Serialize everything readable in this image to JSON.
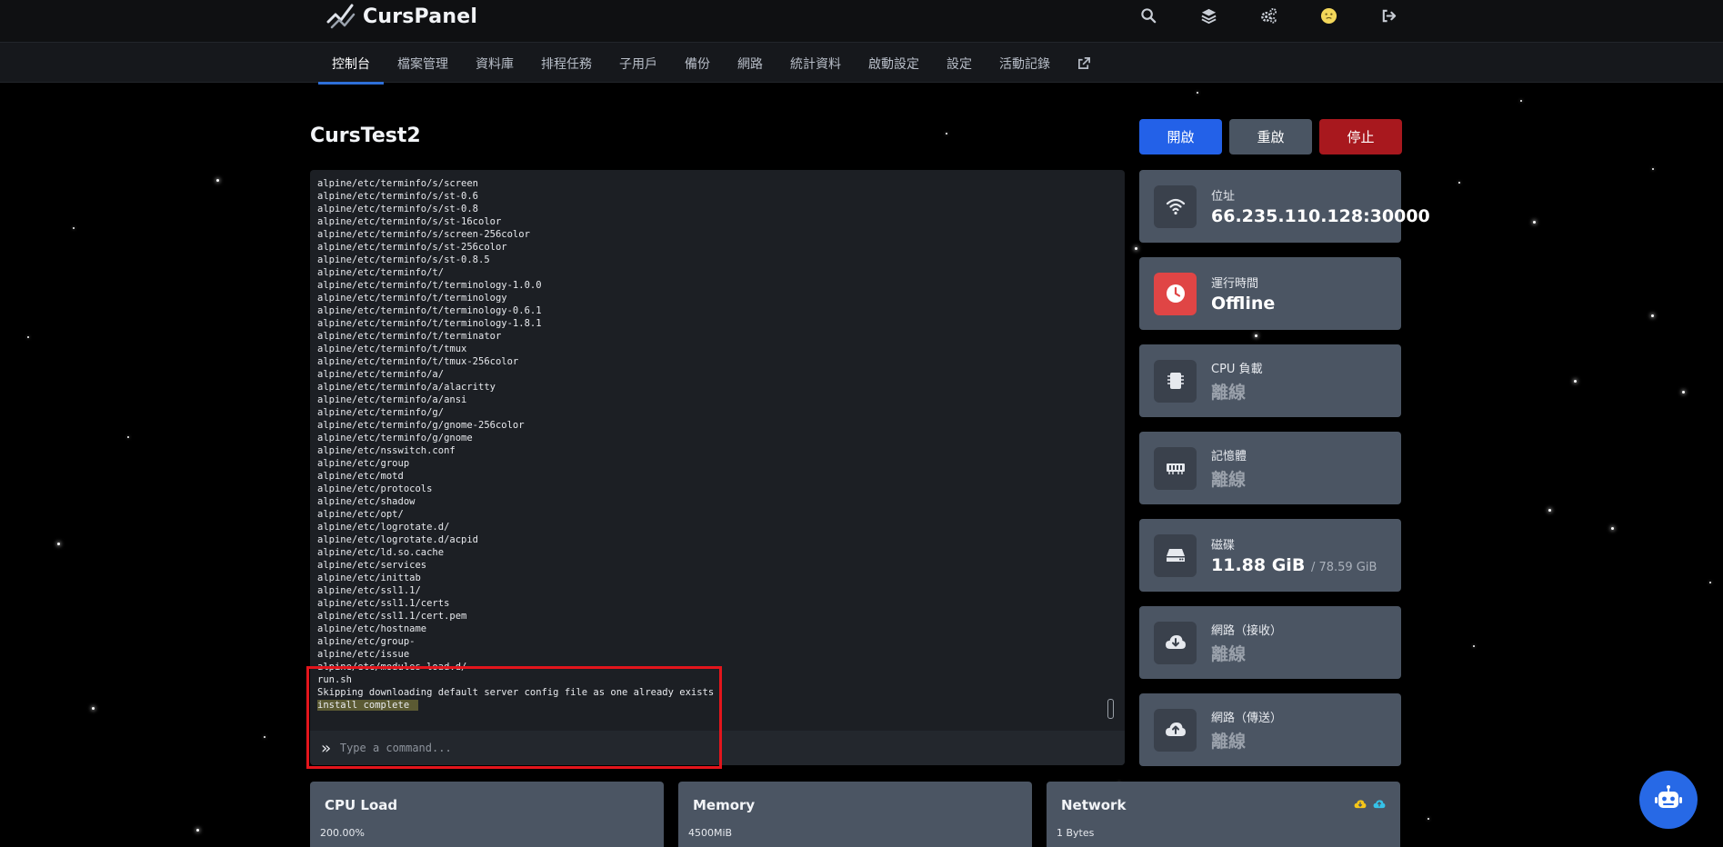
{
  "brand": {
    "name": "CursPanel"
  },
  "nav": {
    "items": [
      "控制台",
      "檔案管理",
      "資料庫",
      "排程任務",
      "子用戶",
      "備份",
      "網路",
      "統計資料",
      "啟動設定",
      "設定",
      "活動記錄"
    ]
  },
  "server": {
    "name": "CursTest2"
  },
  "controls": {
    "start": "開啟",
    "restart": "重啟",
    "stop": "停止"
  },
  "console": {
    "lines": [
      "alpine/etc/terminfo/s/screen",
      "alpine/etc/terminfo/s/st-0.6",
      "alpine/etc/terminfo/s/st-0.8",
      "alpine/etc/terminfo/s/st-16color",
      "alpine/etc/terminfo/s/screen-256color",
      "alpine/etc/terminfo/s/st-256color",
      "alpine/etc/terminfo/s/st-0.8.5",
      "alpine/etc/terminfo/t/",
      "alpine/etc/terminfo/t/terminology-1.0.0",
      "alpine/etc/terminfo/t/terminology",
      "alpine/etc/terminfo/t/terminology-0.6.1",
      "alpine/etc/terminfo/t/terminology-1.8.1",
      "alpine/etc/terminfo/t/terminator",
      "alpine/etc/terminfo/t/tmux",
      "alpine/etc/terminfo/t/tmux-256color",
      "alpine/etc/terminfo/a/",
      "alpine/etc/terminfo/a/alacritty",
      "alpine/etc/terminfo/a/ansi",
      "alpine/etc/terminfo/g/",
      "alpine/etc/terminfo/g/gnome-256color",
      "alpine/etc/terminfo/g/gnome",
      "alpine/etc/nsswitch.conf",
      "alpine/etc/group",
      "alpine/etc/motd",
      "alpine/etc/protocols",
      "alpine/etc/shadow",
      "alpine/etc/opt/",
      "alpine/etc/logrotate.d/",
      "alpine/etc/logrotate.d/acpid",
      "alpine/etc/ld.so.cache",
      "alpine/etc/services",
      "alpine/etc/inittab",
      "alpine/etc/ssl1.1/",
      "alpine/etc/ssl1.1/certs",
      "alpine/etc/ssl1.1/cert.pem",
      "alpine/etc/hostname",
      "alpine/etc/group-",
      "alpine/etc/issue",
      "alpine/etc/modules-load.d/",
      "run.sh",
      "Skipping downloading default server config file as one already exists",
      "install complete"
    ],
    "highlighted_line": "install complete",
    "input_placeholder": "Type a command...",
    "prompt_symbol": "»"
  },
  "stats": {
    "address": {
      "label": "位址",
      "value": "66.235.110.128:30000",
      "icon": "wifi-icon"
    },
    "uptime": {
      "label": "運行時間",
      "value": "Offline",
      "icon": "clock-icon"
    },
    "cpu": {
      "label": "CPU 負載",
      "value": "離線",
      "icon": "cpu-icon"
    },
    "memory": {
      "label": "記憶體",
      "value": "離線",
      "icon": "memory-icon"
    },
    "disk": {
      "label": "磁碟",
      "value": "11.88 GiB",
      "limit": "/ 78.59 GiB",
      "icon": "hdd-icon"
    },
    "net_in": {
      "label": "網路（接收）",
      "value": "離線",
      "icon": "cloud-download-icon"
    },
    "net_out": {
      "label": "網路（傳送）",
      "value": "離線",
      "icon": "cloud-upload-icon"
    }
  },
  "charts": {
    "cpu": {
      "title": "CPU Load",
      "value": "200.00%"
    },
    "memory": {
      "title": "Memory",
      "value": "4500MiB"
    },
    "network": {
      "title": "Network",
      "value": "1 Bytes"
    }
  },
  "colors": {
    "accent": "#2361e8",
    "danger": "#a8181e",
    "neutral": "#4a5563",
    "card": "#4b5563",
    "highlight_box": "#e3151c",
    "clock_icon_bg": "#e04545"
  }
}
